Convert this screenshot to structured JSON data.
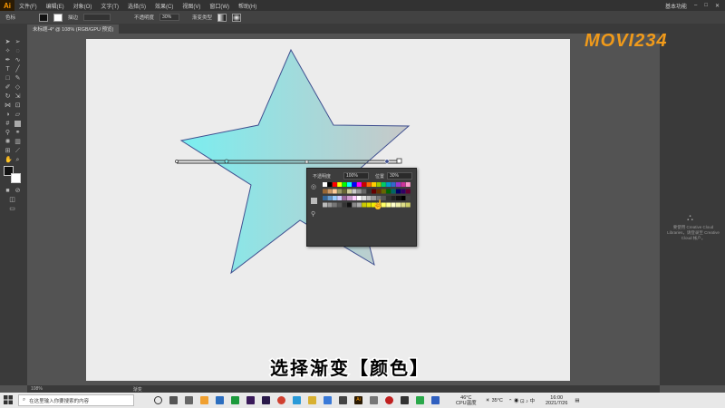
{
  "menubar": {
    "logo": "Ai",
    "menus": [
      "文件(F)",
      "编辑(E)",
      "对象(O)",
      "文字(T)",
      "选择(S)",
      "效果(C)",
      "视图(V)",
      "窗口(W)",
      "帮助(H)"
    ],
    "workspace": "基本功能"
  },
  "control_bar": {
    "label_color": "色标",
    "stroke_label": "描边",
    "opacity_label": "不透明度",
    "opacity_value": "30%",
    "gradient_type_label": "渐变类型"
  },
  "document_tab": {
    "title": "未标题-4* @ 108% (RGB/GPU 预览)"
  },
  "popup": {
    "opacity_label": "不透明度",
    "opacity_value": "100%",
    "position_label": "位置",
    "position_value": "30%"
  },
  "right_panel": {
    "cc_text": "要使用 Creative Cloud Libraries，请登录至 Creative Cloud 帐户。"
  },
  "status_bar": {
    "zoom": "108%",
    "tool": "渐变"
  },
  "caption": "选择渐变【颜色】",
  "watermark": "MOVI234",
  "taskbar": {
    "search_placeholder": "在这里输入你要搜索的内容",
    "weather_temp": "46°C",
    "weather_label": "CPU温度",
    "temp2": "35°C",
    "time": "16:00",
    "date": "2021/7/26"
  },
  "colors": {
    "gradient_start": "#7aeef0",
    "gradient_end": "#c8c8c8",
    "star_stroke": "#3f4f8f",
    "watermark": "#f09a1a"
  }
}
